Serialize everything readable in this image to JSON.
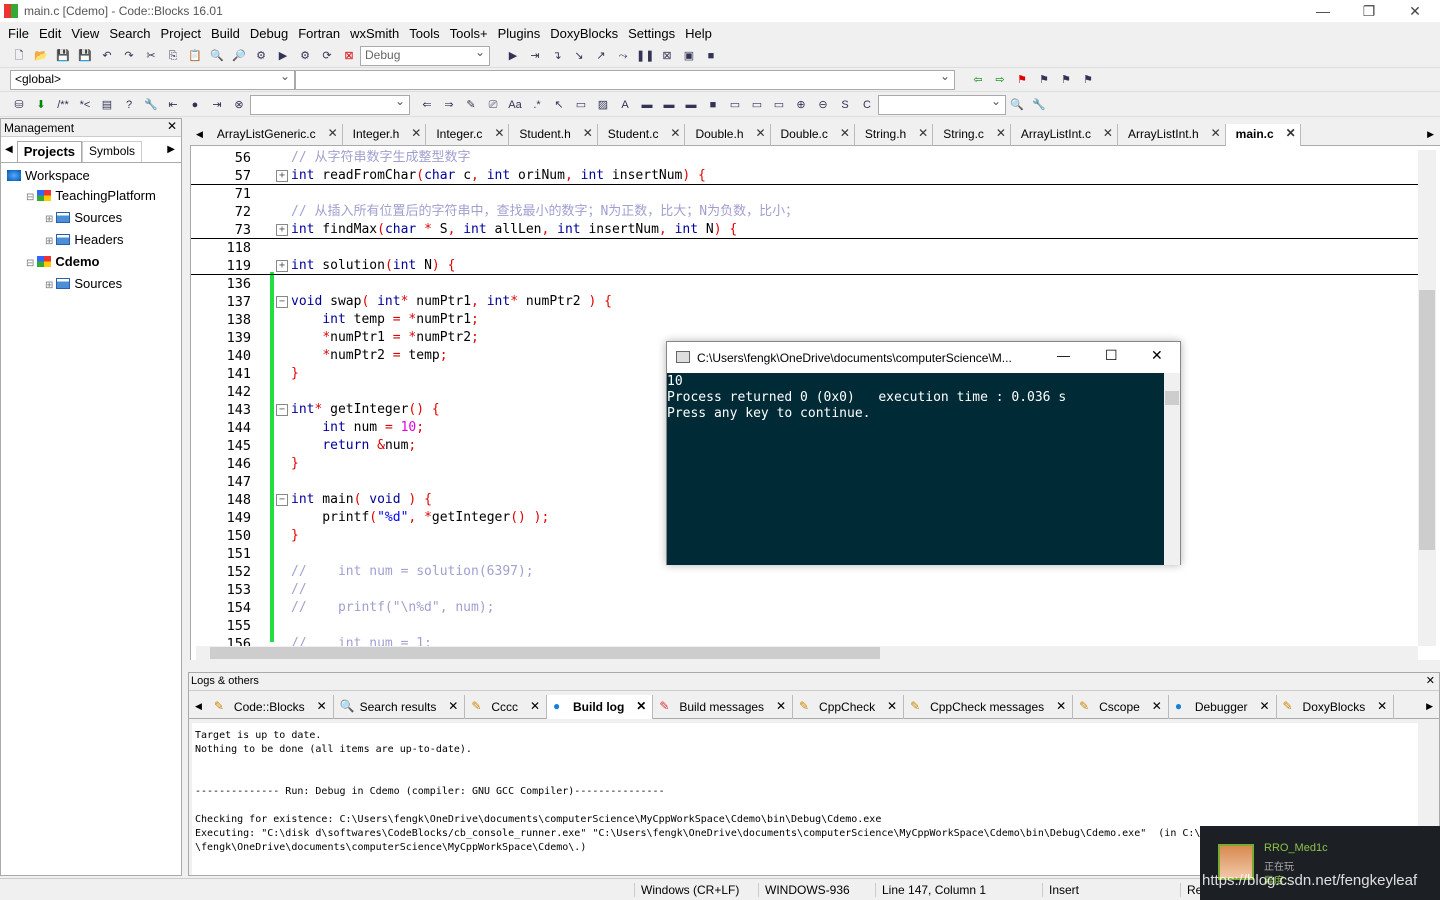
{
  "window": {
    "title": "main.c [Cdemo] - Code::Blocks 16.01"
  },
  "menu": [
    "File",
    "Edit",
    "View",
    "Search",
    "Project",
    "Build",
    "Debug",
    "Fortran",
    "wxSmith",
    "Tools",
    "Tools+",
    "Plugins",
    "DoxyBlocks",
    "Settings",
    "Help"
  ],
  "toolbar": {
    "build_target": "Debug",
    "scope": "<global>"
  },
  "management": {
    "title": "Management",
    "tabs": [
      "Projects",
      "Symbols"
    ],
    "tree": [
      {
        "label": "Workspace",
        "level": 0,
        "bold": false,
        "icon": "workspace-icon"
      },
      {
        "label": "TeachingPlatform",
        "level": 1,
        "bold": false,
        "icon": "project-icon"
      },
      {
        "label": "Sources",
        "level": 2,
        "bold": false,
        "icon": "folder-icon"
      },
      {
        "label": "Headers",
        "level": 2,
        "bold": false,
        "icon": "folder-icon"
      },
      {
        "label": "Cdemo",
        "level": 1,
        "bold": true,
        "icon": "project-icon"
      },
      {
        "label": "Sources",
        "level": 2,
        "bold": false,
        "icon": "folder-icon"
      }
    ]
  },
  "editor_tabs": [
    "ArrayListGeneric.c",
    "Integer.h",
    "Integer.c",
    "Student.h",
    "Student.c",
    "Double.h",
    "Double.c",
    "String.h",
    "String.c",
    "ArrayListInt.c",
    "ArrayListInt.h",
    "main.c"
  ],
  "active_tab": "main.c",
  "code": [
    {
      "n": "56",
      "t": [
        [
          "c",
          "// 从字符串数字生成整型数字"
        ]
      ]
    },
    {
      "n": "57",
      "f": "+",
      "sep": true,
      "t": [
        [
          "k",
          "int"
        ],
        [
          "i",
          " readFromChar"
        ],
        [
          "p",
          "("
        ],
        [
          "k",
          "char"
        ],
        [
          "i",
          " c"
        ],
        [
          "p",
          ","
        ],
        [
          "i",
          " "
        ],
        [
          "k",
          "int"
        ],
        [
          "i",
          " oriNum"
        ],
        [
          "p",
          ","
        ],
        [
          "i",
          " "
        ],
        [
          "k",
          "int"
        ],
        [
          "i",
          " insertNum"
        ],
        [
          "p",
          ")"
        ],
        [
          "i",
          " "
        ],
        [
          "p",
          "{"
        ]
      ]
    },
    {
      "n": "71",
      "t": []
    },
    {
      "n": "72",
      "t": [
        [
          "c",
          "// 从插入所有位置后的字符串中，查找最小的数字；N为正数，比大；N为负数，比小；"
        ]
      ]
    },
    {
      "n": "73",
      "f": "+",
      "sep": true,
      "t": [
        [
          "k",
          "int"
        ],
        [
          "i",
          " findMax"
        ],
        [
          "p",
          "("
        ],
        [
          "k",
          "char"
        ],
        [
          "i",
          " "
        ],
        [
          "p",
          "*"
        ],
        [
          "i",
          " S"
        ],
        [
          "p",
          ","
        ],
        [
          "i",
          " "
        ],
        [
          "k",
          "int"
        ],
        [
          "i",
          " allLen"
        ],
        [
          "p",
          ","
        ],
        [
          "i",
          " "
        ],
        [
          "k",
          "int"
        ],
        [
          "i",
          " insertNum"
        ],
        [
          "p",
          ","
        ],
        [
          "i",
          " "
        ],
        [
          "k",
          "int"
        ],
        [
          "i",
          " N"
        ],
        [
          "p",
          ")"
        ],
        [
          "i",
          " "
        ],
        [
          "p",
          "{"
        ]
      ]
    },
    {
      "n": "118",
      "t": []
    },
    {
      "n": "119",
      "f": "+",
      "sep": true,
      "t": [
        [
          "k",
          "int"
        ],
        [
          "i",
          " solution"
        ],
        [
          "p",
          "("
        ],
        [
          "k",
          "int"
        ],
        [
          "i",
          " N"
        ],
        [
          "p",
          ")"
        ],
        [
          "i",
          " "
        ],
        [
          "p",
          "{"
        ]
      ]
    },
    {
      "n": "136",
      "t": []
    },
    {
      "n": "137",
      "f": "-",
      "t": [
        [
          "k",
          "void"
        ],
        [
          "i",
          " swap"
        ],
        [
          "p",
          "("
        ],
        [
          "i",
          " "
        ],
        [
          "k",
          "int"
        ],
        [
          "p",
          "*"
        ],
        [
          "i",
          " numPtr1"
        ],
        [
          "p",
          ","
        ],
        [
          "i",
          " "
        ],
        [
          "k",
          "int"
        ],
        [
          "p",
          "*"
        ],
        [
          "i",
          " numPtr2 "
        ],
        [
          "p",
          ")"
        ],
        [
          "i",
          " "
        ],
        [
          "p",
          "{"
        ]
      ]
    },
    {
      "n": "138",
      "t": [
        [
          "i",
          "    "
        ],
        [
          "k",
          "int"
        ],
        [
          "i",
          " temp "
        ],
        [
          "p",
          "="
        ],
        [
          "i",
          " "
        ],
        [
          "p",
          "*"
        ],
        [
          "i",
          "numPtr1"
        ],
        [
          "p",
          ";"
        ]
      ]
    },
    {
      "n": "139",
      "t": [
        [
          "i",
          "    "
        ],
        [
          "p",
          "*"
        ],
        [
          "i",
          "numPtr1 "
        ],
        [
          "p",
          "="
        ],
        [
          "i",
          " "
        ],
        [
          "p",
          "*"
        ],
        [
          "i",
          "numPtr2"
        ],
        [
          "p",
          ";"
        ]
      ]
    },
    {
      "n": "140",
      "t": [
        [
          "i",
          "    "
        ],
        [
          "p",
          "*"
        ],
        [
          "i",
          "numPtr2 "
        ],
        [
          "p",
          "="
        ],
        [
          "i",
          " temp"
        ],
        [
          "p",
          ";"
        ]
      ]
    },
    {
      "n": "141",
      "t": [
        [
          "p",
          "}"
        ]
      ]
    },
    {
      "n": "142",
      "t": []
    },
    {
      "n": "143",
      "f": "-",
      "t": [
        [
          "k",
          "int"
        ],
        [
          "p",
          "*"
        ],
        [
          "i",
          " getInteger"
        ],
        [
          "p",
          "()"
        ],
        [
          "i",
          " "
        ],
        [
          "p",
          "{"
        ]
      ]
    },
    {
      "n": "144",
      "t": [
        [
          "i",
          "    "
        ],
        [
          "k",
          "int"
        ],
        [
          "i",
          " num "
        ],
        [
          "p",
          "="
        ],
        [
          "i",
          " "
        ],
        [
          "n",
          "10"
        ],
        [
          "p",
          ";"
        ]
      ]
    },
    {
      "n": "145",
      "t": [
        [
          "i",
          "    "
        ],
        [
          "k",
          "return"
        ],
        [
          "i",
          " "
        ],
        [
          "p",
          "&"
        ],
        [
          "i",
          "num"
        ],
        [
          "p",
          ";"
        ]
      ]
    },
    {
      "n": "146",
      "t": [
        [
          "p",
          "}"
        ]
      ]
    },
    {
      "n": "147",
      "t": []
    },
    {
      "n": "148",
      "f": "-",
      "t": [
        [
          "k",
          "int"
        ],
        [
          "i",
          " main"
        ],
        [
          "p",
          "("
        ],
        [
          "i",
          " "
        ],
        [
          "k",
          "void"
        ],
        [
          "i",
          " "
        ],
        [
          "p",
          ")"
        ],
        [
          "i",
          " "
        ],
        [
          "p",
          "{"
        ]
      ]
    },
    {
      "n": "149",
      "t": [
        [
          "i",
          "    printf"
        ],
        [
          "p",
          "("
        ],
        [
          "s",
          "\"%d\""
        ],
        [
          "p",
          ","
        ],
        [
          "i",
          " "
        ],
        [
          "p",
          "*"
        ],
        [
          "i",
          "getInteger"
        ],
        [
          "p",
          "()"
        ],
        [
          "i",
          " "
        ],
        [
          "p",
          ");"
        ]
      ]
    },
    {
      "n": "150",
      "t": [
        [
          "p",
          "}"
        ]
      ]
    },
    {
      "n": "151",
      "t": []
    },
    {
      "n": "152",
      "t": [
        [
          "c",
          "//    int num = solution(6397);"
        ]
      ]
    },
    {
      "n": "153",
      "t": [
        [
          "c",
          "//"
        ]
      ]
    },
    {
      "n": "154",
      "t": [
        [
          "c",
          "//    printf(\"\\n%d\", num);"
        ]
      ]
    },
    {
      "n": "155",
      "t": []
    },
    {
      "n": "156",
      "t": [
        [
          "c",
          "//    int num = 1;"
        ]
      ]
    }
  ],
  "console": {
    "title": "C:\\Users\\fengk\\OneDrive\\documents\\computerScience\\M...",
    "output": "10\nProcess returned 0 (0x0)   execution time : 0.036 s\nPress any key to continue."
  },
  "logs": {
    "title": "Logs & others",
    "tabs": [
      "Code::Blocks",
      "Search results",
      "Cccc",
      "Build log",
      "Build messages",
      "CppCheck",
      "CppCheck messages",
      "Cscope",
      "Debugger",
      "DoxyBlocks"
    ],
    "active": "Build log",
    "text": "Target is up to date.\nNothing to be done (all items are up-to-date).\n\n\n-------------- Run: Debug in Cdemo (compiler: GNU GCC Compiler)---------------\n\nChecking for existence: C:\\Users\\fengk\\OneDrive\\documents\\computerScience\\MyCppWorkSpace\\Cdemo\\bin\\Debug\\Cdemo.exe\nExecuting: \"C:\\disk d\\softwares\\CodeBlocks/cb_console_runner.exe\" \"C:\\Users\\fengk\\OneDrive\\documents\\computerScience\\MyCppWorkSpace\\Cdemo\\bin\\Debug\\Cdemo.exe\"  (in C:\\Users\n\\fengk\\OneDrive\\documents\\computerScience\\MyCppWorkSpace\\Cdemo\\.)"
  },
  "status": {
    "eol": "Windows (CR+LF)",
    "encoding": "WINDOWS-936",
    "position": "Line 147, Column 1",
    "mode": "Insert",
    "extra": "Re"
  },
  "overlay": {
    "user": "RRO_Med1c",
    "status": "正在玩",
    "game": "异度...",
    "watermark": "https://blog.csdn.net/fengkeyleaf"
  }
}
